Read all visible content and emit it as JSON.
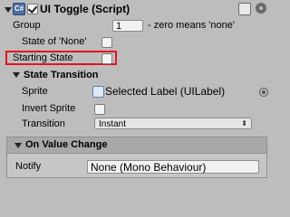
{
  "header": {
    "title": "UI Toggle (Script)",
    "enabled": true,
    "icons": [
      "component-script-icon",
      "help-icon",
      "gear-icon"
    ]
  },
  "fields": {
    "group": {
      "label": "Group",
      "value": "1",
      "hint": "- zero means 'none'"
    },
    "state_of_none": {
      "label": "State of 'None'",
      "checked": false
    },
    "starting_state": {
      "label": "Starting State",
      "checked": false
    }
  },
  "state_transition": {
    "title": "State Transition",
    "sprite": {
      "label": "Sprite",
      "value": "Selected Label (UILabel)"
    },
    "invert_sprite": {
      "label": "Invert Sprite",
      "checked": false
    },
    "transition": {
      "label": "Transition",
      "value": "Instant"
    }
  },
  "on_value_change": {
    "title": "On Value Change",
    "notify": {
      "label": "Notify",
      "value": "None (Mono Behaviour)"
    }
  },
  "colors": {
    "highlight": "#e3141b",
    "background": "#bdbdbd"
  }
}
